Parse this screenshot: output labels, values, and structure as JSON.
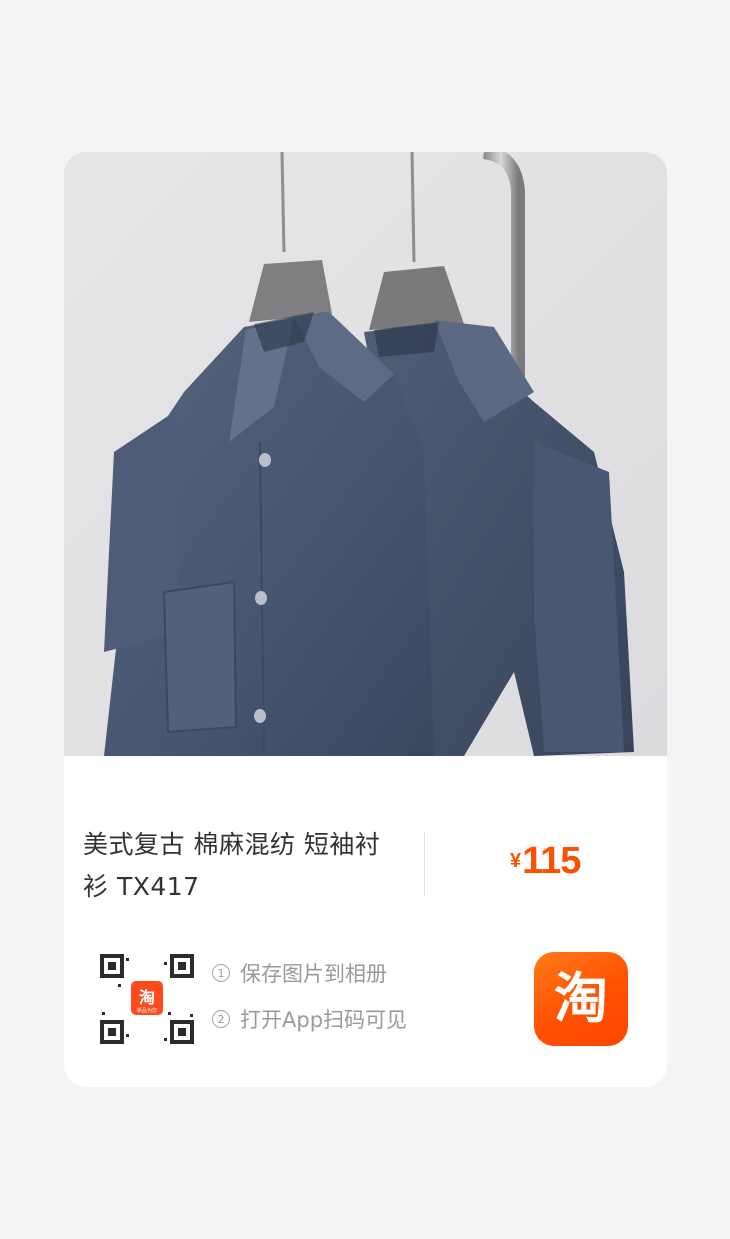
{
  "product": {
    "title_line1": "美式复古 棉麻混纺 短袖衬",
    "title_line2": "衫 TX417",
    "price_symbol": "¥",
    "price_value": "115",
    "price_color": "#ff5000"
  },
  "share": {
    "steps": [
      {
        "index": "1",
        "text": "保存图片到相册"
      },
      {
        "index": "2",
        "text": "打开App扫码可见"
      }
    ],
    "qr_center_logo": "淘",
    "qr_center_caption": "新品为您"
  },
  "app_icon": {
    "glyph": "淘",
    "name": "taobao-app-icon",
    "color": "#ff5000"
  },
  "icons": [
    "shirt-photo",
    "qr-code-icon",
    "taobao-app-icon"
  ]
}
